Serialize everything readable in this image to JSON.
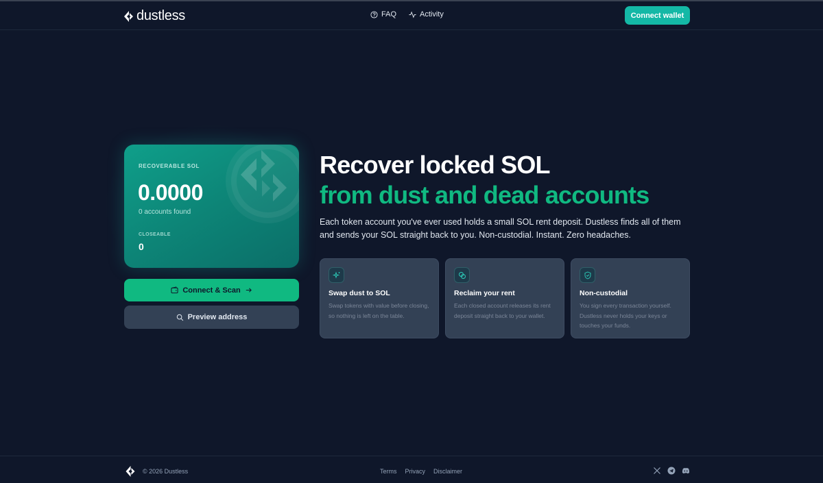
{
  "brand": {
    "name": "dustless",
    "logo_icon": "dustless-logo-icon"
  },
  "nav": [
    {
      "label": "FAQ",
      "icon": "help-circle-icon"
    },
    {
      "label": "Activity",
      "icon": "activity-icon"
    }
  ],
  "header": {
    "connect_label": "Connect wallet"
  },
  "card": {
    "label": "RECOVERABLE SOL",
    "amount": "0.0000",
    "accounts": "0 accounts found",
    "closeable_label": "CLOSEABLE",
    "closeable_value": "0"
  },
  "actions": {
    "scan_label": "Connect & Scan",
    "preview_label": "Preview address"
  },
  "hero": {
    "title": "Recover locked SOL",
    "subtitle": "from dust and dead accounts",
    "description": "Each token account you've ever used holds a small SOL rent deposit. Dustless finds all of them and sends your SOL straight back to you. Non-custodial. Instant. Zero headaches."
  },
  "features": [
    {
      "title": "Swap dust to SOL",
      "description": "Swap tokens with value before closing, so nothing is left on the table.",
      "icon": "sparkles-icon"
    },
    {
      "title": "Reclaim your rent",
      "description": "Each closed account releases its rent deposit straight back to your wallet.",
      "icon": "coins-icon"
    },
    {
      "title": "Non-custodial",
      "description": "You sign every transaction yourself. Dustless never holds your keys or touches your funds.",
      "icon": "shield-check-icon"
    }
  ],
  "footer": {
    "copyright": "© 2026 Dustless",
    "links": [
      "Terms",
      "Privacy",
      "Disclaimer"
    ],
    "socials": [
      "x-icon",
      "telegram-icon",
      "discord-icon"
    ]
  },
  "colors": {
    "background": "#0f172a",
    "accent": "#14b8a6",
    "accent_green": "#10b981",
    "surface": "#334155"
  }
}
